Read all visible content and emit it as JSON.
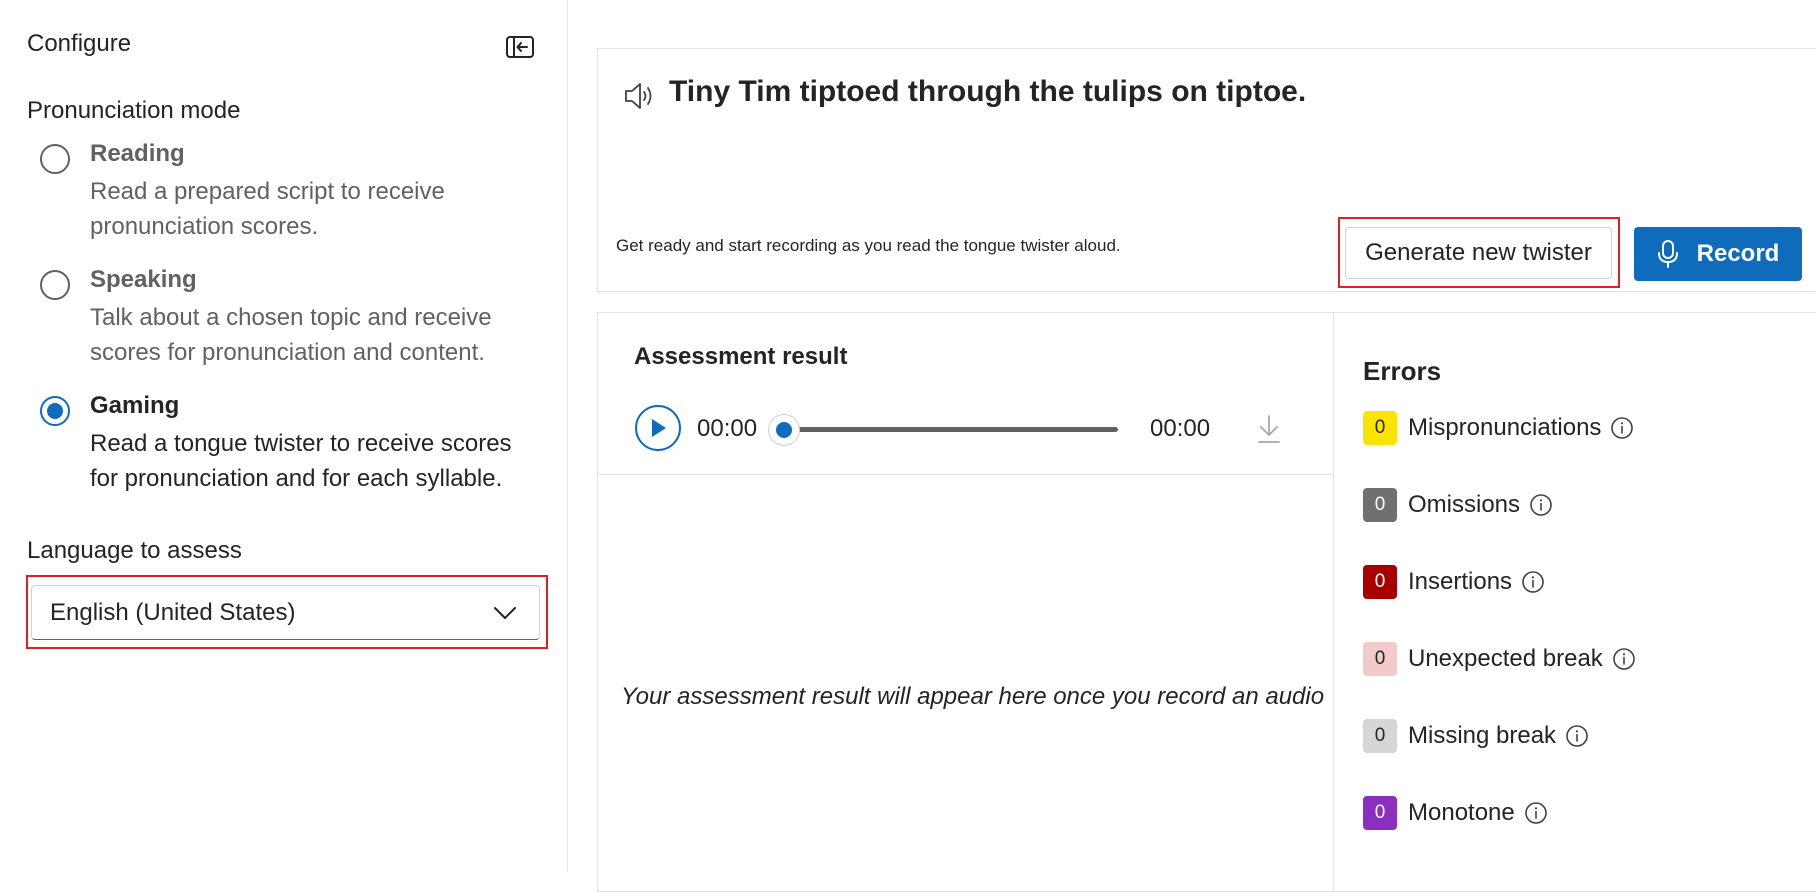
{
  "configure": {
    "title": "Configure",
    "mode_label": "Pronunciation mode",
    "modes": [
      {
        "title": "Reading",
        "desc": "Read a prepared script to receive pronunciation scores.",
        "selected": false
      },
      {
        "title": "Speaking",
        "desc": "Talk about a chosen topic and receive scores for pronunciation and content.",
        "selected": false
      },
      {
        "title": "Gaming",
        "desc": "Read a tongue twister to receive scores for pronunciation and for each syllable.",
        "selected": true
      }
    ],
    "language_label": "Language to assess",
    "language_value": "English (United States)"
  },
  "twister": {
    "text": "Tiny Tim tiptoed through the tulips on tiptoe.",
    "hint": "Get ready and start recording as you read the tongue twister aloud.",
    "generate_label": "Generate new twister",
    "record_label": "Record"
  },
  "assessment": {
    "title": "Assessment result",
    "time_start": "00:00",
    "time_end": "00:00",
    "progress": 0,
    "placeholder": "Your assessment result will appear here once you record an audio"
  },
  "errors": {
    "title": "Errors",
    "items": [
      {
        "label": "Mispronunciations",
        "count": "0",
        "color": "#fde300",
        "text_color": "#242424"
      },
      {
        "label": "Omissions",
        "count": "0",
        "color": "#707070",
        "text_color": "#ffffff"
      },
      {
        "label": "Insertions",
        "count": "0",
        "color": "#a80000",
        "text_color": "#ffffff"
      },
      {
        "label": "Unexpected break",
        "count": "0",
        "color": "#f2caca",
        "text_color": "#242424"
      },
      {
        "label": "Missing break",
        "count": "0",
        "color": "#d6d6d6",
        "text_color": "#242424"
      },
      {
        "label": "Monotone",
        "count": "0",
        "color": "#8a2fc0",
        "text_color": "#ffffff"
      }
    ]
  },
  "colors": {
    "accent": "#0f6cbd",
    "highlight": "#e02020"
  }
}
